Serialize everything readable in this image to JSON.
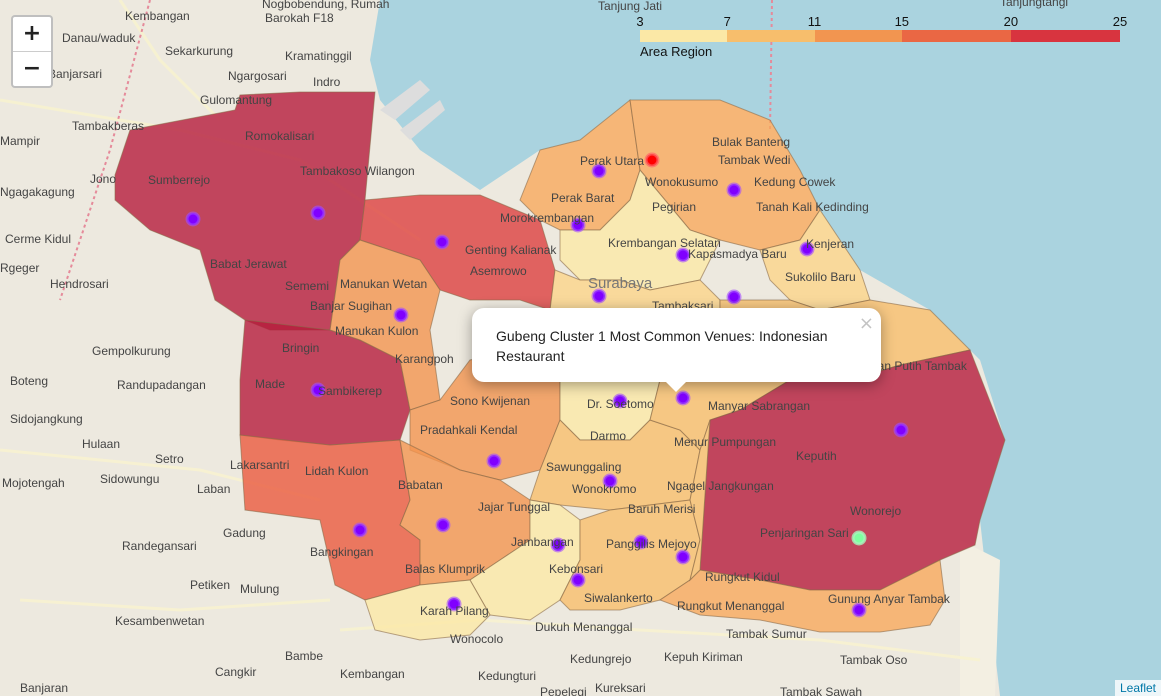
{
  "zoom": {
    "in_label": "+",
    "out_label": "−"
  },
  "legend": {
    "caption": "Area Region",
    "ticks": [
      "3",
      "7",
      "11",
      "15",
      "20",
      "25"
    ],
    "min": 3,
    "max": 25,
    "colors": [
      "#fbe8a6",
      "#f7be6c",
      "#f29550",
      "#ea6744",
      "#d8343f",
      "#b51b3c"
    ]
  },
  "popup": {
    "text": "Gubeng Cluster 1 Most Common Venues: Indonesian Restaurant",
    "close": "×"
  },
  "attribution": "Leaflet",
  "map_labels": [
    "Tanjung Jati",
    "Kembangan",
    "Nogbobendung, Rumah",
    "Barokah F18",
    "Danau/waduk",
    "Sekarkurung",
    "Kramatinggil",
    "Banjarsari",
    "Ngargosari",
    "Indro",
    "Gulomantung",
    "Tambakberas",
    "Mampir",
    "Jono",
    "Sumberrejo",
    "Romokalisari",
    "Tambakoso Wilangon",
    "Ngagakagung",
    "Cerme Kidul",
    "Rgeger",
    "Hendrosari",
    "Babat Jerawat",
    "Sememi",
    "Genting Kalianak",
    "Asemrowo",
    "Manukan Wetan",
    "Banjar Sugihan",
    "Manukan Kulon",
    "Bringin",
    "Gempolkurung",
    "Karangpoh",
    "Boteng",
    "Randupadangan",
    "Made",
    "Sambikerep",
    "Sidojangkung",
    "Hulaan",
    "Sono Kwijenan",
    "Pradahkali Kendal",
    "Setro",
    "Sidowungu",
    "Lakarsantri",
    "Lidah Kulon",
    "Mojotengah",
    "Laban",
    "Babatan",
    "Jajar Tunggal",
    "Gadung",
    "Randegansari",
    "Bangkingan",
    "Balas Klumprik",
    "Petiken",
    "Mulung",
    "Kesambenwetan",
    "Karah Pilang",
    "Wonocolo",
    "Bambe",
    "Cangkir",
    "Kembangan",
    "Kedungturi",
    "Banjaran",
    "Perak Utara",
    "Perak Barat",
    "Morokrembangan",
    "Krembangan Selatan",
    "Surabaya",
    "Wonokusumo",
    "Pegirian",
    "Bulak Banteng",
    "Tambak Wedi",
    "Kedung Cowek",
    "Tanah Kali Kedinding",
    "Kenjeran",
    "Sukolilo Baru",
    "Kapasmadya Baru",
    "Tambaksari",
    "Dr. Soetomo",
    "Darmo",
    "Manyar Sabrangan",
    "Menur Pumpungan",
    "Keputih",
    "Kejawan Putih Tambak",
    "Sawunggaling",
    "Wonokromo",
    "Ngagel Jangkungan",
    "Baruh Merisi",
    "Wonorejo",
    "Penjaringan Sari",
    "Jambangan",
    "Kebonsari",
    "Panggilis Mejoyo",
    "Rungkut Kidul",
    "Siwalankerto",
    "Dukuh Menanggal",
    "Rungkut Menanggal",
    "Gunung Anyar Tambak",
    "Tambak Sumur",
    "Kedungrejo",
    "Kepuh Kiriman",
    "Tambak Oso",
    "Kureksari",
    "Pepelegi",
    "Tambak Sawah",
    "Tanjungtangi"
  ],
  "markers": [
    {
      "name": "gubeng-cluster-1",
      "color": "#8000ff"
    },
    {
      "name": "sememi-marker",
      "color": "#8000ff"
    }
  ]
}
